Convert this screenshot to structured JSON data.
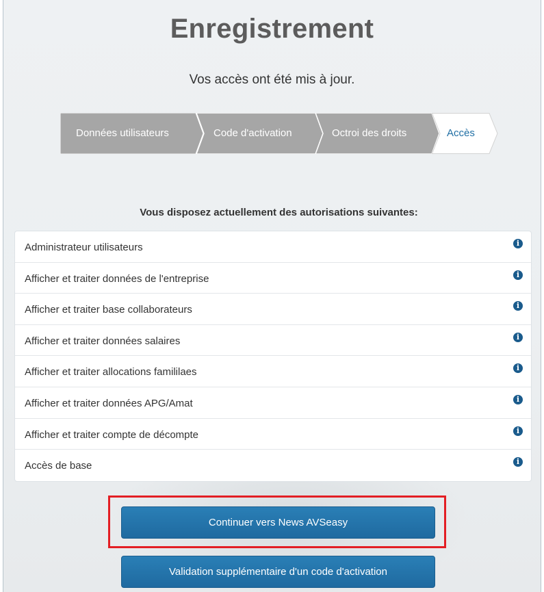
{
  "page": {
    "title": "Enregistrement",
    "subtitle": "Vos accès ont été mis à jour."
  },
  "steps": [
    {
      "label": "Données utilisateurs",
      "state": "done"
    },
    {
      "label": "Code d'activation",
      "state": "done"
    },
    {
      "label": "Octroi des droits",
      "state": "done"
    },
    {
      "label": "Accès",
      "state": "active"
    }
  ],
  "permissions": {
    "heading": "Vous disposez actuellement des autorisations suivantes:",
    "items": [
      {
        "label": "Administrateur utilisateurs",
        "icon": "info-icon"
      },
      {
        "label": "Afficher et traiter données de l'entreprise",
        "icon": "info-icon"
      },
      {
        "label": "Afficher et traiter base collaborateurs",
        "icon": "info-icon"
      },
      {
        "label": "Afficher et traiter données salaires",
        "icon": "info-icon"
      },
      {
        "label": "Afficher et traiter allocations famililaes",
        "icon": "info-icon"
      },
      {
        "label": "Afficher et traiter données APG/Amat",
        "icon": "info-icon"
      },
      {
        "label": "Afficher et traiter compte de décompte",
        "icon": "info-icon"
      },
      {
        "label": "Accès de base",
        "icon": "info-icon"
      }
    ]
  },
  "actions": {
    "continue_label": "Continuer vers News AVSeasy",
    "validate_label": "Validation supplémentaire d'un code d'activation"
  },
  "colors": {
    "primary": "#1f6aa0",
    "step_done": "#a6a6a6",
    "step_active_text": "#1f6ea4",
    "highlight": "#e31e24",
    "info_icon": "#1a5b8c"
  }
}
